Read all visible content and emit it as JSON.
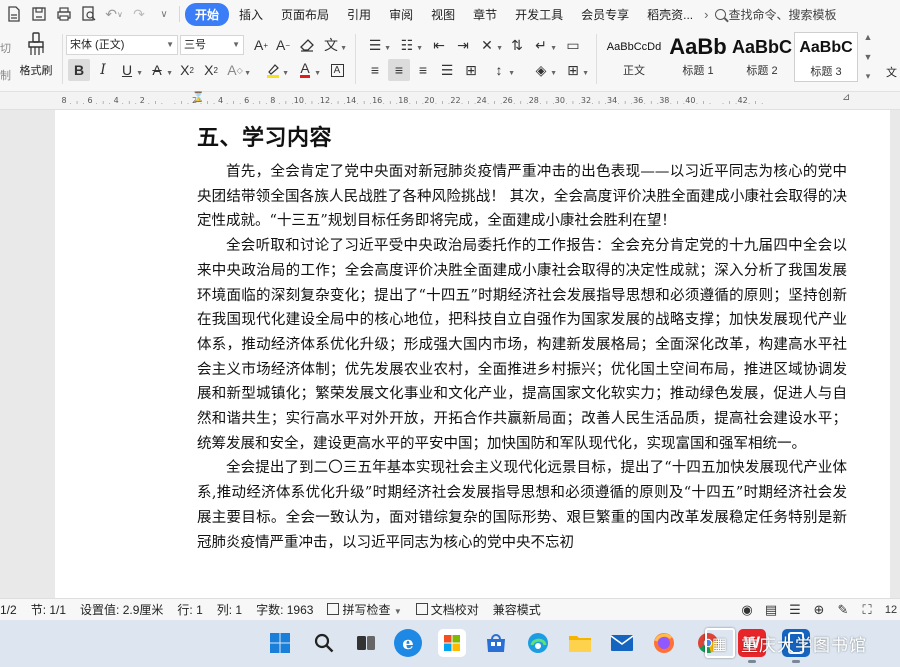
{
  "menubar": {
    "tabs": [
      {
        "label": "开始",
        "active": true
      },
      {
        "label": "插入"
      },
      {
        "label": "页面布局"
      },
      {
        "label": "引用"
      },
      {
        "label": "审阅"
      },
      {
        "label": "视图"
      },
      {
        "label": "章节"
      },
      {
        "label": "开发工具"
      },
      {
        "label": "会员专享"
      },
      {
        "label": "稻壳资..."
      }
    ],
    "search_label": "查找命令、搜索模板",
    "accent_color": "#3b7df6"
  },
  "ribbon": {
    "left_small": [
      "切",
      "制"
    ],
    "format_painter_label": "格式刷",
    "font_name": "宋体 (正文)",
    "font_size": "三号",
    "styles": [
      {
        "preview": "AaBbCcDd",
        "name": "正文"
      },
      {
        "preview": "AaBb",
        "name": "标题 1"
      },
      {
        "preview": "AaBbC",
        "name": "标题 2"
      },
      {
        "preview": "AaBbC",
        "name": "标题 3"
      }
    ],
    "right_text": "文"
  },
  "ruler": {
    "numbers": [
      "8",
      "6",
      "4",
      "2",
      "",
      "2",
      "4",
      "6",
      "8",
      "10",
      "12",
      "14",
      "16",
      "18",
      "20",
      "22",
      "24",
      "26",
      "28",
      "30",
      "32",
      "34",
      "36",
      "38",
      "40",
      "",
      "42"
    ]
  },
  "document": {
    "heading": "五、学习内容",
    "paragraphs": [
      "首先，全会肯定了党中央面对新冠肺炎疫情严重冲击的出色表现——以习近平同志为核心的党中央团结带领全国各族人民战胜了各种风险挑战！ 其次，全会高度评价决胜全面建成小康社会取得的决定性成就。“十三五”规划目标任务即将完成，全面建成小康社会胜利在望！",
      "全会听取和讨论了习近平受中央政治局委托作的工作报告：全会充分肯定党的十九届四中全会以来中央政治局的工作；全会高度评价决胜全面建成小康社会取得的决定性成就；深入分析了我国发展环境面临的深刻复杂变化；提出了“十四五”时期经济社会发展指导思想和必须遵循的原则；坚持创新在我国现代化建设全局中的核心地位，把科技自立自强作为国家发展的战略支撑；加快发展现代产业体系，推动经济体系优化升级；形成强大国内市场，构建新发展格局；全面深化改革，构建高水平社会主义市场经济体制；优先发展农业农村，全面推进乡村振兴；优化国土空间布局，推进区域协调发展和新型城镇化；繁荣发展文化事业和文化产业，提高国家文化软实力；推动绿色发展，促进人与自然和谐共生；实行高水平对外开放，开拓合作共赢新局面；改善人民生活品质，提高社会建设水平；统筹发展和安全，建设更高水平的平安中国；加快国防和军队现代化，实现富国和强军相统一。",
      "全会提出了到二〇三五年基本实现社会主义现代化远景目标，提出了“十四五加快发展现代产业体系,推动经济体系优化升级”时期经济社会发展指导思想和必须遵循的原则及“十四五”时期经济社会发展主要目标。全会一致认为，面对错综复杂的国际形势、艰巨繁重的国内改革发展稳定任务特别是新冠肺炎疫情严重冲击，以习近平同志为核心的党中央不忘初"
    ]
  },
  "statusbar": {
    "page": "1/2",
    "section": "节: 1/1",
    "setting": "设置值: 2.9厘米",
    "row": "行: 1",
    "col": "列: 1",
    "word_count": "字数: 1963",
    "spellcheck": "拼写检查",
    "doc_proof": "文档校对",
    "compat": "兼容模式",
    "zoom_hint": "12"
  },
  "taskbar": {
    "watermark": "重庆大学图书馆"
  }
}
